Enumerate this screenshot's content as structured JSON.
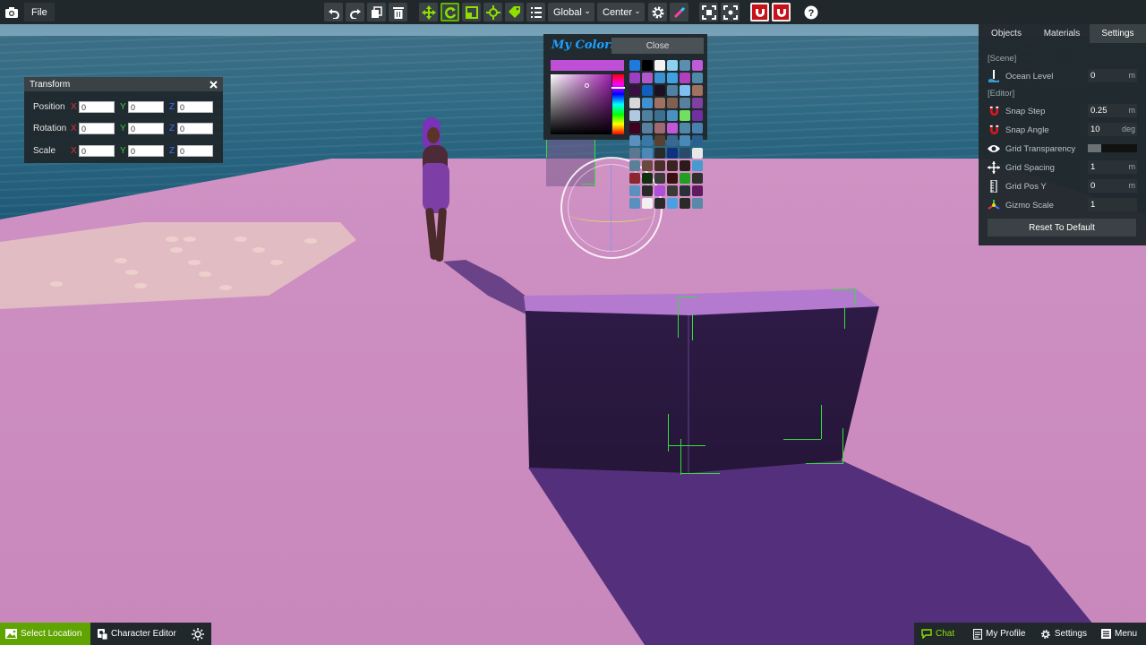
{
  "toolbar": {
    "file_label": "File",
    "space_dropdown": "Global",
    "pivot_dropdown": "Center"
  },
  "transform_panel": {
    "title": "Transform",
    "rows": [
      {
        "label": "Position",
        "x": "0",
        "y": "0",
        "z": "0"
      },
      {
        "label": "Rotation",
        "x": "0",
        "y": "0",
        "z": "0"
      },
      {
        "label": "Scale",
        "x": "0",
        "y": "0",
        "z": "0"
      }
    ],
    "axis_labels": {
      "x": "X",
      "y": "Y",
      "z": "Z"
    }
  },
  "color_picker": {
    "title": "My Colors",
    "close_label": "Close",
    "current_color": "#c04fd8",
    "swatches": [
      "#1f7ae0",
      "#000000",
      "#f2f2f2",
      "#8cd0f0",
      "#5a8fb0",
      "#c05ad8",
      "#9a40c0",
      "#b058c8",
      "#3a90d0",
      "#40a0e0",
      "#b040c0",
      "#5088a8",
      "#3a1040",
      "#1060c0",
      "#1a1020",
      "#5080a0",
      "#80c0f0",
      "#a07060",
      "#d8d8d8",
      "#4090d0",
      "#a07060",
      "#806050",
      "#5a80a0",
      "#8040a0",
      "#b0c8e0",
      "#5080a0",
      "#3a7090",
      "#4a90c0",
      "#70e060",
      "#7030a0",
      "#400020",
      "#5a80a0",
      "#a06870",
      "#c058d8",
      "#5088a8",
      "#4a80b0",
      "#5a90c0",
      "#3a78a8",
      "#5a4030",
      "#3a6890",
      "#4a88b8",
      "#2a6090",
      "#5a7890",
      "#4a88b8",
      "#2a2a2a",
      "#103080",
      "#2a4a6a",
      "#e8e8e8",
      "#5a8098",
      "#6a4a40",
      "#4a3028",
      "#3a2420",
      "#2a1a1a",
      "#4a9ad0",
      "#8a2830",
      "#103010",
      "#3a3a3a",
      "#3a1010",
      "#20a020",
      "#303030",
      "#5a90c0",
      "#2a2a2a",
      "#b050d8",
      "#3a3a3a",
      "#2a3038",
      "#601a60",
      "#5a90c0",
      "#f0f0f0",
      "#2a2a2a",
      "#4aa0e0",
      "#2a2a2a",
      "#5a88a8"
    ]
  },
  "right_panel": {
    "tabs": [
      "Objects",
      "Materials",
      "Settings"
    ],
    "active_tab": "Settings",
    "scene_section": "[Scene]",
    "editor_section": "[Editor]",
    "ocean_level": {
      "label": "Ocean Level",
      "value": "0",
      "unit": "m"
    },
    "snap_step": {
      "label": "Snap Step",
      "value": "0.25",
      "unit": "m"
    },
    "snap_angle": {
      "label": "Snap Angle",
      "value": "10",
      "unit": "deg"
    },
    "grid_transparency": {
      "label": "Grid Transparency",
      "level": 0.28
    },
    "grid_spacing": {
      "label": "Grid Spacing",
      "value": "1",
      "unit": "m"
    },
    "grid_pos_y": {
      "label": "Grid Pos Y",
      "value": "0",
      "unit": "m"
    },
    "gizmo_scale": {
      "label": "Gizmo Scale",
      "value": "1"
    },
    "reset_label": "Reset To Default"
  },
  "bottom_left": {
    "select_location": "Select Location",
    "character_editor": "Character Editor"
  },
  "bottom_right": {
    "chat": "Chat",
    "my_profile": "My Profile",
    "settings": "Settings",
    "menu": "Menu"
  },
  "colors": {
    "toolbar_bg": "#20282c",
    "accent_green": "#5fb800",
    "magnet_red": "#c8121a",
    "panel_bg": "#20282c",
    "selection_green": "#32e03a"
  }
}
